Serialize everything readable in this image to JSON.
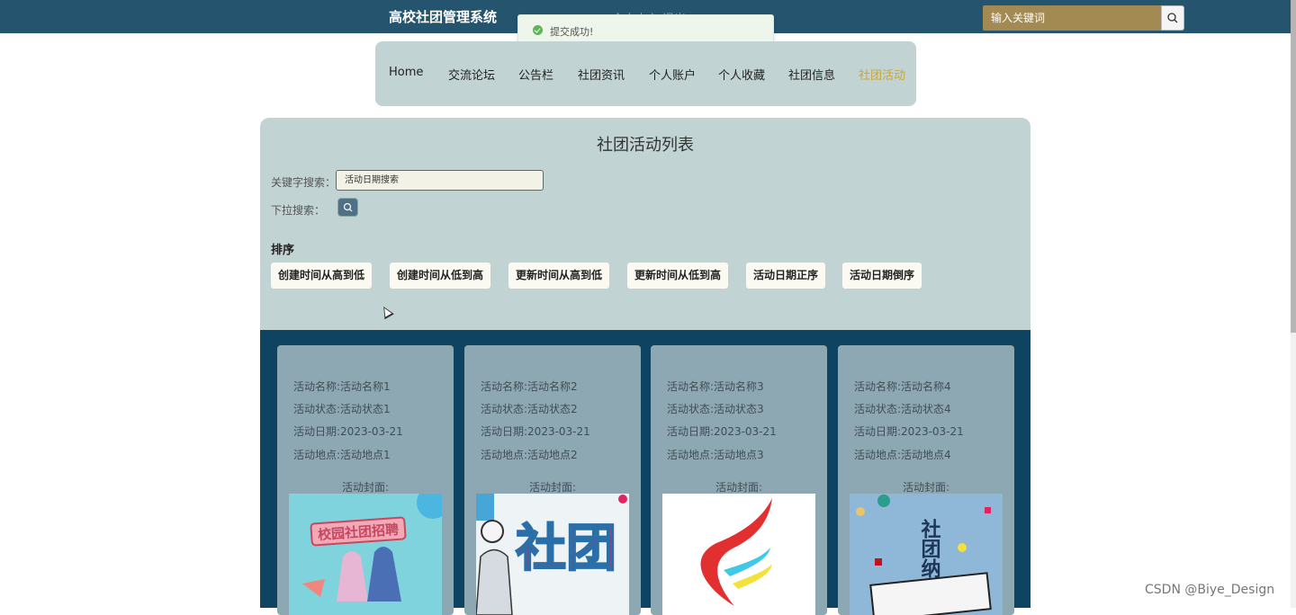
{
  "header": {
    "site_title": "高校社团管理系统",
    "faded_text": "个人中心  退出",
    "search_placeholder": "输入关键词",
    "search_icon": "search-icon"
  },
  "toast": {
    "message": "提交成功!",
    "icon": "check-circle-icon",
    "color": "#5fb45a"
  },
  "nav": {
    "items": [
      "Home",
      "交流论坛",
      "公告栏",
      "社团资讯",
      "个人账户",
      "个人收藏",
      "社团信息",
      "社团活动"
    ],
    "active": "社团活动",
    "active_color": "#c9a53d"
  },
  "panel": {
    "title": "社团活动列表",
    "keyword_label": "关键字搜索：",
    "keyword_value": "活动日期搜索",
    "dropdown_label": "下拉搜索：",
    "sort_title": "排序",
    "sort_buttons": [
      "创建时间从高到低",
      "创建时间从低到高",
      "更新时间从高到低",
      "更新时间从低到高",
      "活动日期正序",
      "活动日期倒序"
    ]
  },
  "activities": [
    {
      "name": "活动名称:活动名称1",
      "status": "活动状态:活动状态1",
      "date": "活动日期:2023-03-21",
      "place": "活动地点:活动地点1",
      "cover_label": "活动封面:",
      "cover_text": "校园社团招聘"
    },
    {
      "name": "活动名称:活动名称2",
      "status": "活动状态:活动状态2",
      "date": "活动日期:2023-03-21",
      "place": "活动地点:活动地点2",
      "cover_label": "活动封面:",
      "cover_text": "社团"
    },
    {
      "name": "活动名称:活动名称3",
      "status": "活动状态:活动状态3",
      "date": "活动日期:2023-03-21",
      "place": "活动地点:活动地点3",
      "cover_label": "活动封面:",
      "cover_text": ""
    },
    {
      "name": "活动名称:活动名称4",
      "status": "活动状态:活动状态4",
      "date": "活动日期:2023-03-21",
      "place": "活动地点:活动地点4",
      "cover_label": "活动封面:",
      "cover_text": "社团纳新"
    }
  ],
  "colors": {
    "topbar": "#25546e",
    "panel": "#c2d3d3",
    "list_area": "#0e4462",
    "card": "#8ea8b3"
  },
  "watermark": "CSDN @Biye_Design"
}
